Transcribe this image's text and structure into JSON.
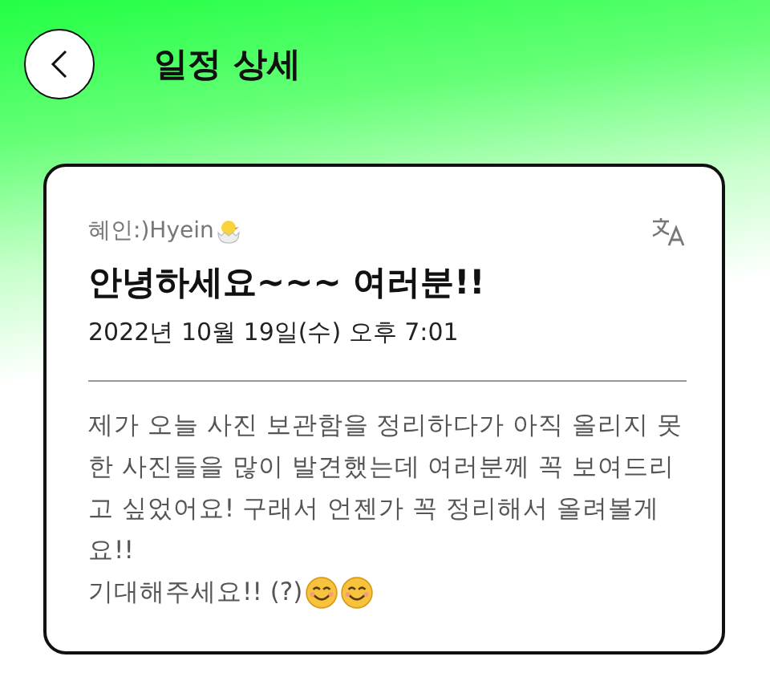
{
  "header": {
    "title": "일정 상세"
  },
  "post": {
    "author": "혜인:)Hyein",
    "title": "안녕하세요~~~ 여러분!!",
    "date": "2022년 10월 19일(수) 오후 7:01",
    "paragraphs": [
      "제가 오늘 사진 보관함을 정리하다가 아직 올리지 못한 사진들을 많이 발견했는데 여러분께 꼭 보여드리고 싶었어요! 구래서 언젠가 꼭 정리해서 올려볼게요!!",
      "기대해주세요!! (?)"
    ]
  }
}
